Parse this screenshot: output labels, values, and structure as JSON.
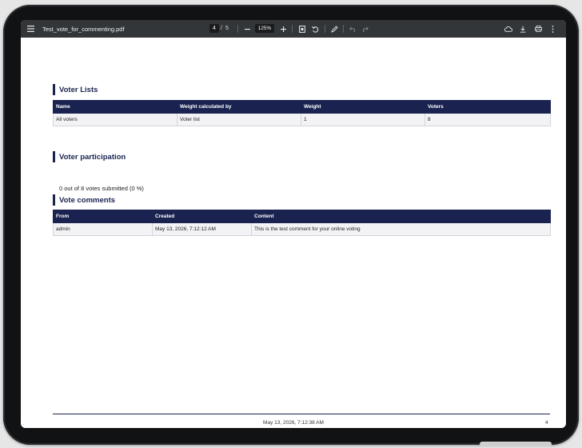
{
  "viewer": {
    "file_name": "Test_vote_for_commenting.pdf",
    "current_page": "4",
    "page_separator": "/",
    "total_pages": "5",
    "zoom": "125%"
  },
  "document": {
    "voter_lists": {
      "title": "Voter Lists",
      "columns": [
        "Name",
        "Weight calculated by",
        "Weight",
        "Voters"
      ],
      "rows": [
        [
          "All voters",
          "Voter list",
          "1",
          "8"
        ]
      ]
    },
    "participation": {
      "title": "Voter participation",
      "text": "0 out of 8 votes submitted (0 %)"
    },
    "comments": {
      "title": "Vote comments",
      "columns": [
        "From",
        "Created",
        "Content"
      ],
      "rows": [
        [
          "admin",
          "May 13, 2026, 7:12:12 AM",
          "This is the test comment for your online voting"
        ]
      ]
    },
    "footer": {
      "timestamp": "May 13, 2026, 7:12:38 AM",
      "page_number": "4"
    }
  },
  "icons": {
    "menu": "menu-icon",
    "zoom_out": "minus-icon",
    "zoom_in": "plus-icon",
    "fit_page": "fit-page-icon",
    "rotate": "rotate-icon",
    "annotate": "draw-icon",
    "undo": "undo-icon",
    "redo": "redo-icon",
    "drive": "cloud-save-icon",
    "download": "download-icon",
    "print": "print-icon",
    "more": "more-vert-icon"
  },
  "colors": {
    "toolbar_bg": "#323639",
    "header_navy": "#1a2350",
    "row_bg": "#f3f3f6"
  }
}
